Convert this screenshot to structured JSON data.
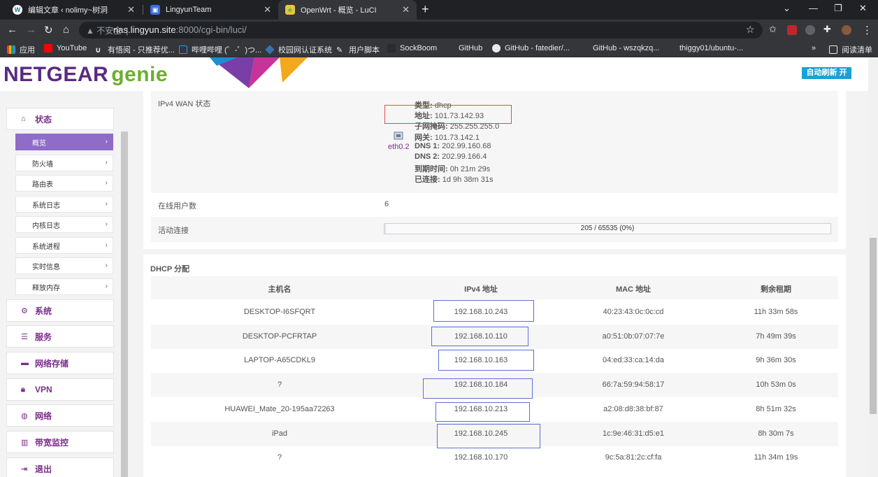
{
  "browser": {
    "tabs": [
      {
        "title": "编辑文章 ‹ nolimy~树洞",
        "active": false
      },
      {
        "title": "LingyunTeam",
        "active": false
      },
      {
        "title": "OpenWrt - 概览 - LuCI",
        "active": true
      }
    ],
    "address": {
      "warning": "不安全",
      "host": "nas.lingyun.site",
      "path": ":8000/cgi-bin/luci/"
    },
    "bookmarks": [
      "应用",
      "YouTube",
      "有悟阅 - 只推荐优...",
      "哔哩哔哩 (゜-゜)つ...",
      "校园网认证系统",
      "用户脚本",
      "SockBoom",
      "GitHub",
      "GitHub - fatedier/...",
      "GitHub - wszqkzq...",
      "thiggy01/ubuntu-..."
    ],
    "bookmarks_more": "»",
    "reading_list": "阅读清单"
  },
  "header": {
    "logo_main": "NETGEAR",
    "logo_sub": "genie",
    "auto_refresh": "自动刷新 开"
  },
  "sidebar": {
    "status": "状态",
    "subitems": [
      "概览",
      "防火墙",
      "路由表",
      "系统日志",
      "内核日志",
      "系统进程",
      "实时信息",
      "释放内存"
    ],
    "items": [
      "系统",
      "服务",
      "网络存储",
      "VPN",
      "网络",
      "带宽监控",
      "退出"
    ]
  },
  "wan": {
    "label": "IPv4 WAN 状态",
    "iface": "eth0.2",
    "lines": [
      {
        "k": "类型:",
        "v": "dhcp"
      },
      {
        "k": "地址:",
        "v": "101.73.142.93"
      },
      {
        "k": "子网掩码:",
        "v": "255.255.255.0"
      },
      {
        "k": "网关:",
        "v": "101.73.142.1"
      },
      {
        "k": "DNS 1:",
        "v": "202.99.160.68"
      },
      {
        "k": "DNS 2:",
        "v": "202.99.166.4"
      },
      {
        "k": "到期时间:",
        "v": "0h 21m 29s"
      },
      {
        "k": "已连接:",
        "v": "1d 9h 38m 31s"
      }
    ]
  },
  "online_users": {
    "label": "在线用户数",
    "value": "6"
  },
  "active_conn": {
    "label": "活动连接",
    "value": "205 / 65535 (0%)",
    "fraction": 0.003
  },
  "dhcp": {
    "title": "DHCP 分配",
    "headers": [
      "主机名",
      "IPv4 地址",
      "MAC 地址",
      "剩余租期"
    ],
    "rows": [
      [
        "DESKTOP-I6SFQRT",
        "192.168.10.243",
        "40:23:43:0c:0c:cd",
        "11h 33m 58s"
      ],
      [
        "DESKTOP-PCFRTAP",
        "192.168.10.110",
        "a0:51:0b:07:07:7e",
        "7h 49m 39s"
      ],
      [
        "LAPTOP-A65CDKL9",
        "192.168.10.163",
        "04:ed:33:ca:14:da",
        "9h 36m 30s"
      ],
      [
        "?",
        "192.168.10.184",
        "66:7a:59:94:58:17",
        "10h 53m 0s"
      ],
      [
        "HUAWEI_Mate_20-195aa72263",
        "192.168.10.213",
        "a2:08:d8:38:bf:87",
        "8h 51m 32s"
      ],
      [
        "iPad",
        "192.168.10.245",
        "1c:9e:46:31:d5:e1",
        "8h 30m 7s"
      ],
      [
        "?",
        "192.168.10.170",
        "9c:5a:81:2c:cf:fa",
        "11h 34m 19s"
      ]
    ]
  },
  "colors": {
    "brand": "#5b2a83",
    "accent": "#1aa1d6",
    "active_menu": "#8e6cc8",
    "annotation_red": "#e34c4c",
    "annotation_blue": "#5b6fd6"
  }
}
